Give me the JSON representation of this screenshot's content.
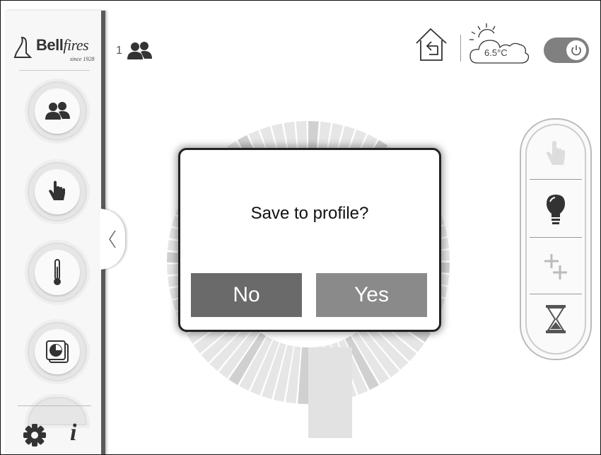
{
  "brand": {
    "name_bold": "Bell",
    "name_italic": "fires",
    "tagline": "since 1928"
  },
  "header": {
    "user_count": "1",
    "temperature": "6.5°C"
  },
  "sidebar": {
    "buttons": [
      {
        "icon": "users-icon"
      },
      {
        "icon": "hand-icon"
      },
      {
        "icon": "thermometer-icon"
      },
      {
        "icon": "timer-icon"
      },
      {
        "icon": "partial-dial-icon"
      }
    ],
    "bottom": [
      {
        "icon": "settings-icon"
      },
      {
        "icon": "info-icon",
        "label": "i"
      }
    ]
  },
  "mode_panel": {
    "items": [
      "hand-icon",
      "bulb-icon",
      "boost-icon",
      "hourglass-icon"
    ]
  },
  "dialog": {
    "title": "Save to profile?",
    "no_label": "No",
    "yes_label": "Yes"
  },
  "colors": {
    "button_no": "#6a6a6a",
    "button_yes": "#8a8a8a",
    "toggle": "#808080",
    "dial_light": "#e0e0e0"
  }
}
